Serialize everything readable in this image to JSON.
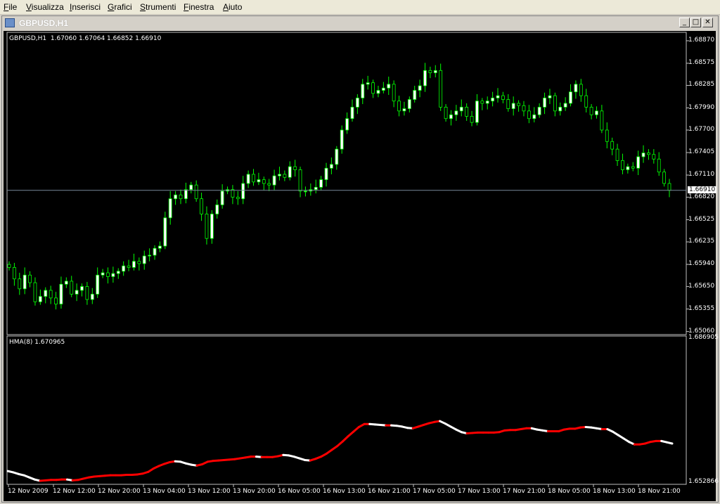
{
  "menu": [
    {
      "hot": "F",
      "rest": "ile"
    },
    {
      "hot": "V",
      "rest": "isualizza"
    },
    {
      "hot": "I",
      "rest": "nserisci"
    },
    {
      "hot": "G",
      "rest": "rafici"
    },
    {
      "hot": "S",
      "rest": "trumenti"
    },
    {
      "hot": "F",
      "rest": "inestra"
    },
    {
      "hot": "A",
      "rest": "iuto"
    }
  ],
  "window": {
    "title": "GBPUSD,H1",
    "min_glyph": "_",
    "max_glyph": "□",
    "close_glyph": "✕"
  },
  "main_legend": "GBPUSD,H1  1.67060 1.67064 1.66852 1.66910",
  "sub_legend": "HMA(8) 1.670965",
  "current_price": "1.66910",
  "colors": {
    "background": "#000000",
    "bull_candle": "#ffffff",
    "bear_candle": "#000000",
    "wick": "#00ff00",
    "hma_up": "#ffffff",
    "hma_down": "#ff0000",
    "price_line": "#778899"
  },
  "chart_data": [
    {
      "type": "candlestick",
      "symbol": "GBPUSD",
      "timeframe": "H1",
      "y_ticks": [
        1.6887,
        1.68575,
        1.68285,
        1.6799,
        1.677,
        1.67405,
        1.6711,
        1.6682,
        1.66525,
        1.66235,
        1.6594,
        1.6565,
        1.65355,
        1.6506
      ],
      "y_tick_labels": [
        "1.68870",
        "1.68575",
        "1.68285",
        "1.67990",
        "1.67700",
        "1.67405",
        "1.67110",
        "1.66820",
        "1.66525",
        "1.66235",
        "1.65940",
        "1.65650",
        "1.65355",
        "1.65060"
      ],
      "ylim": [
        1.6502,
        1.6898
      ],
      "x_labels": [
        "12 Nov 2009",
        "12 Nov 12:00",
        "12 Nov 20:00",
        "13 Nov 04:00",
        "13 Nov 12:00",
        "13 Nov 20:00",
        "16 Nov 05:00",
        "16 Nov 13:00",
        "16 Nov 21:00",
        "17 Nov 05:00",
        "17 Nov 13:00",
        "17 Nov 21:00",
        "18 Nov 05:00",
        "18 Nov 13:00",
        "18 Nov 21:00"
      ],
      "closes": [
        1.659,
        1.6575,
        1.6562,
        1.658,
        1.657,
        1.6545,
        1.6552,
        1.656,
        1.655,
        1.6542,
        1.6568,
        1.6572,
        1.6555,
        1.656,
        1.6565,
        1.6548,
        1.6555,
        1.658,
        1.6583,
        1.6578,
        1.6582,
        1.6585,
        1.6592,
        1.659,
        1.6598,
        1.6595,
        1.6605,
        1.6606,
        1.6615,
        1.6618,
        1.6655,
        1.668,
        1.6685,
        1.668,
        1.6692,
        1.6698,
        1.668,
        1.666,
        1.6628,
        1.666,
        1.6672,
        1.669,
        1.6692,
        1.6682,
        1.668,
        1.67,
        1.6712,
        1.6702,
        1.6705,
        1.67,
        1.6698,
        1.671,
        1.6712,
        1.6708,
        1.6722,
        1.6718,
        1.669,
        1.669,
        1.6692,
        1.6695,
        1.6705,
        1.672,
        1.6725,
        1.6745,
        1.677,
        1.6785,
        1.68,
        1.6812,
        1.683,
        1.6832,
        1.6818,
        1.6822,
        1.6825,
        1.683,
        1.6808,
        1.6795,
        1.6798,
        1.681,
        1.6822,
        1.6828,
        1.6848,
        1.6845,
        1.6848,
        1.68,
        1.6785,
        1.679,
        1.6795,
        1.68,
        1.6788,
        1.678,
        1.6808,
        1.6805,
        1.6808,
        1.6812,
        1.6815,
        1.681,
        1.6798,
        1.6805,
        1.6802,
        1.6795,
        1.6785,
        1.679,
        1.68,
        1.6812,
        1.6815,
        1.6795,
        1.68,
        1.6805,
        1.682,
        1.683,
        1.6815,
        1.68,
        1.679,
        1.6795,
        1.677,
        1.6755,
        1.6745,
        1.673,
        1.6718,
        1.6722,
        1.672,
        1.6735,
        1.674,
        1.6738,
        1.6732,
        1.6715,
        1.67,
        1.6691
      ]
    },
    {
      "type": "line",
      "name": "HMA(8)",
      "ylim": [
        1.652866,
        1.686905
      ],
      "y_tick_labels": [
        "1.686905",
        "1.652866"
      ],
      "values": [
        1.6555,
        1.6552,
        1.6548,
        1.6545,
        1.654,
        1.6535,
        1.6532,
        1.6533,
        1.6534,
        1.6534,
        1.6535,
        1.6535,
        1.6533,
        1.6534,
        1.6537,
        1.654,
        1.6542,
        1.6543,
        1.6544,
        1.6545,
        1.6545,
        1.6545,
        1.6546,
        1.6546,
        1.6547,
        1.6549,
        1.6553,
        1.6561,
        1.6567,
        1.6572,
        1.6576,
        1.6578,
        1.6577,
        1.6573,
        1.657,
        1.6568,
        1.6571,
        1.6577,
        1.6579,
        1.658,
        1.6581,
        1.6582,
        1.6583,
        1.6585,
        1.6587,
        1.6589,
        1.6589,
        1.6588,
        1.6588,
        1.6588,
        1.659,
        1.6593,
        1.6592,
        1.6589,
        1.6585,
        1.6581,
        1.658,
        1.6584,
        1.6589,
        1.6596,
        1.6605,
        1.6614,
        1.6625,
        1.6637,
        1.6648,
        1.6659,
        1.6666,
        1.6666,
        1.6665,
        1.6664,
        1.6663,
        1.6663,
        1.6662,
        1.666,
        1.6657,
        1.6656,
        1.666,
        1.6664,
        1.6668,
        1.6671,
        1.6673,
        1.6667,
        1.666,
        1.6653,
        1.6647,
        1.6644,
        1.6645,
        1.6646,
        1.6646,
        1.6646,
        1.6646,
        1.6647,
        1.6651,
        1.6652,
        1.6652,
        1.6654,
        1.6656,
        1.6656,
        1.6653,
        1.6651,
        1.6649,
        1.6649,
        1.6649,
        1.6653,
        1.6655,
        1.6655,
        1.6658,
        1.6659,
        1.6658,
        1.6656,
        1.6654,
        1.6654,
        1.6648,
        1.664,
        1.6632,
        1.6624,
        1.6618,
        1.6618,
        1.662,
        1.6624,
        1.6626,
        1.6626,
        1.6623,
        1.662
      ]
    }
  ]
}
